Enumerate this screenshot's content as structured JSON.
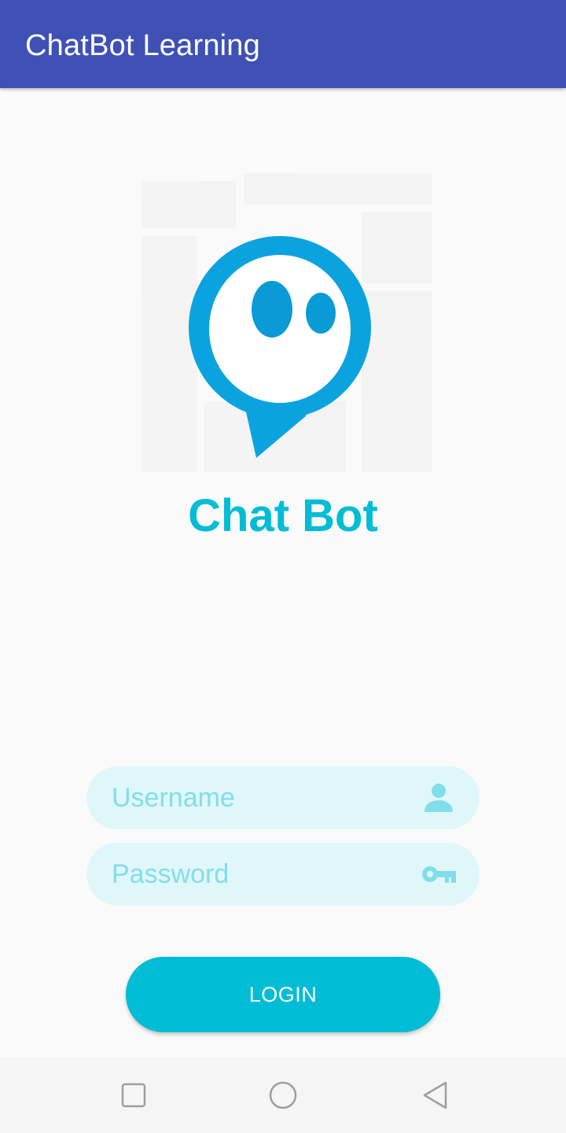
{
  "app_bar": {
    "title": "ChatBot Learning",
    "color": "#3f51b5"
  },
  "brand": {
    "title": "Chat Bot",
    "color": "#00bcd4",
    "logo_icon": "chat-bubble-eyes-icon"
  },
  "login_form": {
    "username": {
      "placeholder": "Username",
      "value": "",
      "icon": "person-icon"
    },
    "password": {
      "placeholder": "Password",
      "value": "",
      "icon": "key-icon"
    },
    "login_label": "LOGIN",
    "field_bg": "#e0f7fa",
    "accent": "#00bcd4"
  },
  "nav_bar": {
    "items": [
      "recents-icon",
      "home-icon",
      "back-icon"
    ]
  }
}
